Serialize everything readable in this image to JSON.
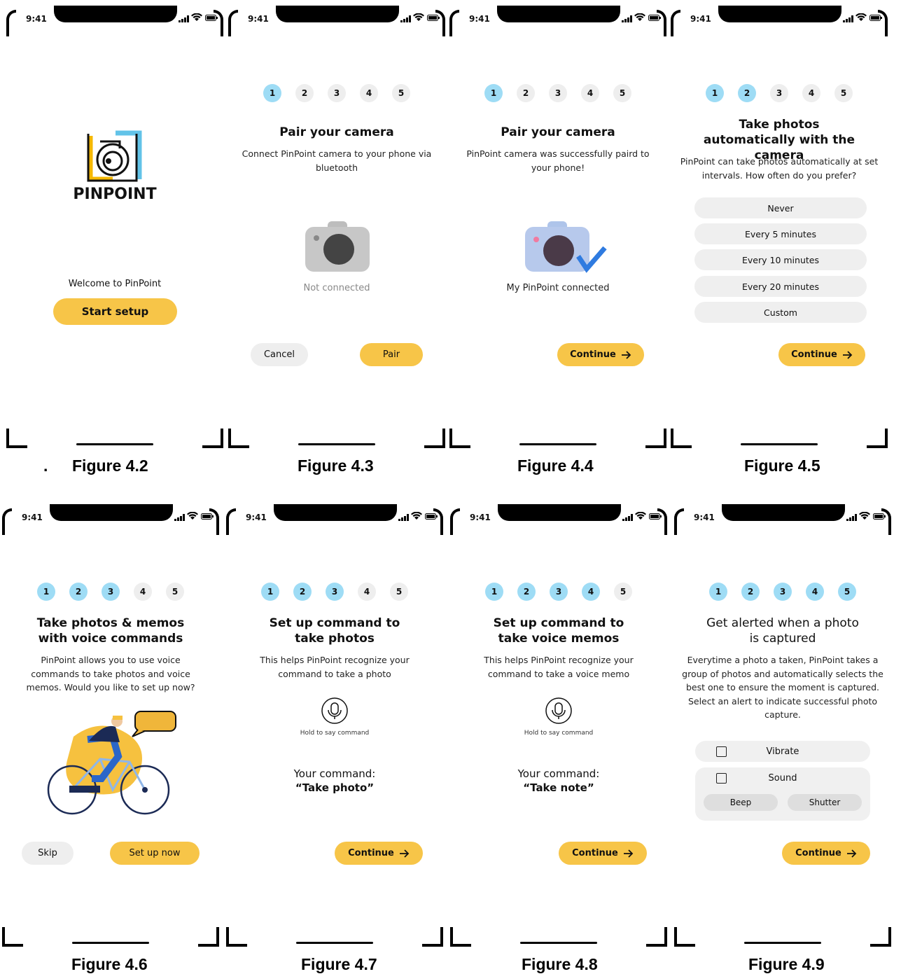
{
  "status": {
    "time": "9:41"
  },
  "steps": [
    "1",
    "2",
    "3",
    "4",
    "5"
  ],
  "figures": {
    "f42": {
      "dot": ".",
      "caption": "Figure 4.2",
      "logo_text": "PINPOINT",
      "welcome": "Welcome to PinPoint",
      "button": "Start setup"
    },
    "f43": {
      "caption": "Figure 4.3",
      "title": "Pair your camera",
      "desc": "Connect PinPoint camera to your phone via bluetooth",
      "status": "Not connected",
      "cancel": "Cancel",
      "pair": "Pair",
      "active_steps": 1
    },
    "f44": {
      "caption": "Figure 4.4",
      "title": "Pair your camera",
      "desc": "PinPoint camera was successfully paird to your phone!",
      "status": "My PinPoint connected",
      "continue": "Continue",
      "active_steps": 1
    },
    "f45": {
      "caption": "Figure 4.5",
      "title": "Take photos automatically with the camera",
      "desc": "PinPoint can take photos automatically at set intervals. How often do you prefer?",
      "options": [
        "Never",
        "Every 5 minutes",
        "Every 10 minutes",
        "Every 20 minutes",
        "Custom"
      ],
      "continue": "Continue",
      "active_steps": 2
    },
    "f46": {
      "caption": "Figure 4.6",
      "title": "Take photos & memos with voice commands",
      "desc": "PinPoint allows you to use voice commands to take photos and voice memos. Would you like to set up now?",
      "skip": "Skip",
      "setup": "Set up now",
      "active_steps": 3
    },
    "f47": {
      "caption": "Figure 4.7",
      "title": "Set up command to take photos",
      "desc": "This helps PinPoint recognize your command to take a photo",
      "hold": "Hold to say command",
      "cmd_label": "Your command:",
      "cmd_value": "“Take photo”",
      "continue": "Continue",
      "active_steps": 3
    },
    "f48": {
      "caption": "Figure 4.8",
      "title": "Set up command to take voice memos",
      "desc": "This helps PinPoint recognize your command to take a voice memo",
      "hold": "Hold to say command",
      "cmd_label": "Your command:",
      "cmd_value": "“Take note”",
      "continue": "Continue",
      "active_steps": 4
    },
    "f49": {
      "caption": "Figure 4.9",
      "title": "Get alerted when a photo is captured",
      "desc": "Everytime a photo a taken, PinPoint takes a group of photos and automatically selects the best one to ensure the moment is captured. Select an alert to indicate successful photo capture.",
      "vibrate": "Vibrate",
      "sound": "Sound",
      "beep": "Beep",
      "shutter": "Shutter",
      "continue": "Continue",
      "active_steps": 5
    }
  },
  "colors": {
    "accent": "#f7c548",
    "step_active": "#9edcf5",
    "chip": "#eeeeee",
    "check_blue": "#2f7be0"
  }
}
